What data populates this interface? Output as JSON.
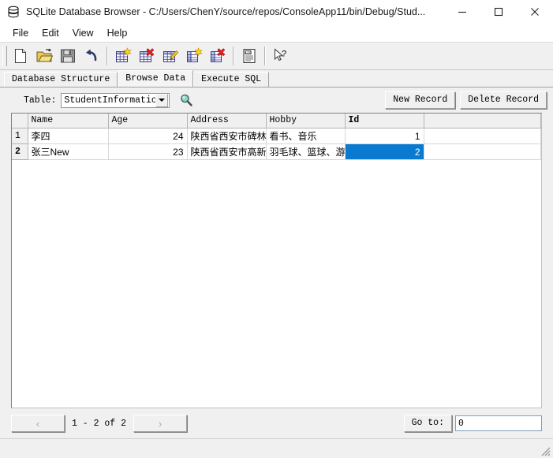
{
  "window": {
    "title": "SQLite Database Browser - C:/Users/ChenY/source/repos/ConsoleApp11/bin/Debug/Stud...",
    "app_icon": "database-icon",
    "controls": {
      "minimize": "minimize-icon",
      "maximize": "maximize-icon",
      "close": "close-icon"
    }
  },
  "menubar": {
    "items": [
      {
        "label": "File"
      },
      {
        "label": "Edit"
      },
      {
        "label": "View"
      },
      {
        "label": "Help"
      }
    ]
  },
  "toolbar": {
    "buttons": [
      {
        "name": "new-database-icon",
        "tooltip": "New Database"
      },
      {
        "name": "open-database-icon",
        "tooltip": "Open Database"
      },
      {
        "name": "save-database-icon",
        "tooltip": "Write Changes"
      },
      {
        "name": "revert-changes-icon",
        "tooltip": "Revert Changes"
      },
      {
        "name": "create-table-icon",
        "tooltip": "Create Table"
      },
      {
        "name": "delete-table-icon",
        "tooltip": "Delete Table"
      },
      {
        "name": "modify-table-icon",
        "tooltip": "Modify Table"
      },
      {
        "name": "create-index-icon",
        "tooltip": "Create Index"
      },
      {
        "name": "delete-index-icon",
        "tooltip": "Delete Index"
      },
      {
        "name": "log-icon",
        "tooltip": "Log"
      },
      {
        "name": "whats-this-icon",
        "tooltip": "What's This?"
      }
    ]
  },
  "tabs": [
    {
      "label": "Database Structure",
      "selected": false
    },
    {
      "label": "Browse Data",
      "selected": true
    },
    {
      "label": "Execute SQL",
      "selected": false
    }
  ],
  "browse": {
    "table_label": "Table:",
    "table_selected": "StudentInformation",
    "search_icon": "magnifier-icon",
    "new_record_label": "New Record",
    "delete_record_label": "Delete Record"
  },
  "grid": {
    "columns": [
      "Name",
      "Age",
      "Address",
      "Hobby",
      "Id"
    ],
    "bold_column": "Id",
    "rows": [
      {
        "row_number": "1",
        "Name": "李四",
        "Age": "24",
        "Address": "陕西省西安市碑林",
        "Hobby": "看书、音乐",
        "Id": "1"
      },
      {
        "row_number": "2",
        "Name": "张三New",
        "Age": "23",
        "Address": "陕西省西安市高新",
        "Hobby": "羽毛球、篮球、游",
        "Id": "2"
      }
    ],
    "selected_cell": {
      "row": 2,
      "column": "Id",
      "value": "2"
    },
    "selection_color": "#0a7ad0"
  },
  "pagination": {
    "prev_label": "‹",
    "next_label": "›",
    "range_text": "1 - 2 of 2",
    "goto_label": "Go to:",
    "goto_value": "0"
  }
}
